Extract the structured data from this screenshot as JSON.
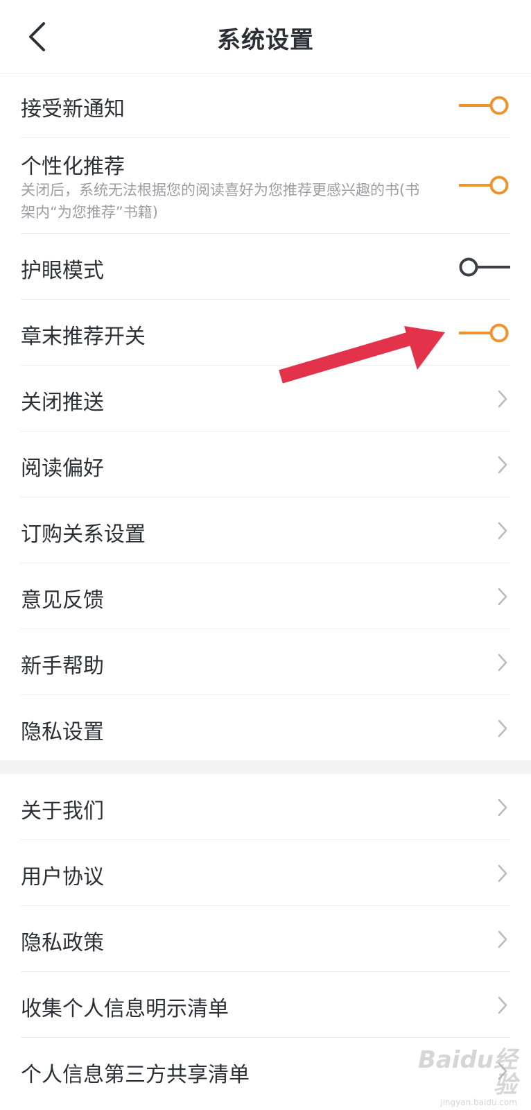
{
  "header": {
    "title": "系统设置",
    "back_icon": "chevron-left-icon"
  },
  "settings": {
    "accept_notifications": {
      "label": "接受新通知",
      "enabled": true
    },
    "personalized_recommendation": {
      "label": "个性化推荐",
      "description": "关闭后，系统无法根据您的阅读喜好为您推荐更感兴趣的书(书架内“为您推荐”书籍)",
      "enabled": true
    },
    "eye_protection_mode": {
      "label": "护眼模式",
      "enabled": false
    },
    "chapter_end_recommendation": {
      "label": "章末推荐开关",
      "enabled": true
    }
  },
  "menu_group_1": [
    {
      "label": "关闭推送"
    },
    {
      "label": "阅读偏好"
    },
    {
      "label": "订购关系设置"
    },
    {
      "label": "意见反馈"
    },
    {
      "label": "新手帮助"
    },
    {
      "label": "隐私设置"
    }
  ],
  "menu_group_2": [
    {
      "label": "关于我们"
    },
    {
      "label": "用户协议"
    },
    {
      "label": "隐私政策"
    },
    {
      "label": "收集个人信息明示清单"
    },
    {
      "label": "个人信息第三方共享清单"
    }
  ],
  "watermark": {
    "brand": "Baidu经验",
    "domain": "jingyan.baidu.com"
  },
  "colors": {
    "toggle_on": "#f0922b",
    "toggle_off": "#3a3f48",
    "annotation_arrow": "#e2334a",
    "chevron": "#b8bcc2",
    "section_gap": "#f4f4f6"
  }
}
